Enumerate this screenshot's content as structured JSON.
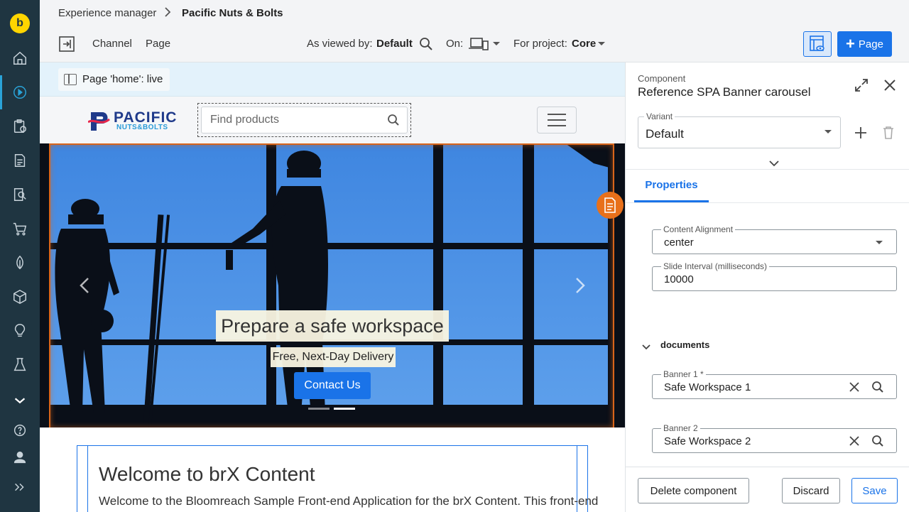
{
  "colors": {
    "nav_bg": "#1f3541",
    "accent": "#1a73e8",
    "brand_yellow": "#ffd500",
    "highlight_orange": "#e8701a"
  },
  "topbar": {
    "breadcrumb_app": "Experience manager",
    "breadcrumb_channel": "Pacific Nuts & Bolts",
    "channel_label": "Channel",
    "page_label": "Page",
    "viewed_by_label": "As viewed by:",
    "viewed_by_value": "Default",
    "on_label": "On:",
    "project_label": "For project:",
    "project_value": "Core",
    "page_button_label": "Page"
  },
  "page_status": {
    "label": "Page 'home': live"
  },
  "site": {
    "logo_line1": "PACIFIC",
    "logo_line2": "NUTS&BOLTS",
    "search_placeholder": "Find products",
    "banner": {
      "title": "Prepare a safe workspace",
      "subtitle": "Free, Next-Day Delivery",
      "button_label": "Contact Us"
    },
    "welcome_title": "Welcome to brX Content",
    "welcome_text": "Welcome to the Bloomreach Sample Front-end Application for the brX Content. This front-end"
  },
  "panel": {
    "kicker": "Component",
    "title": "Reference SPA Banner carousel",
    "variant_label": "Variant",
    "variant_value": "Default",
    "tab_properties": "Properties",
    "content_alignment_label": "Content Alignment",
    "content_alignment_value": "center",
    "slide_interval_label": "Slide Interval (milliseconds)",
    "slide_interval_value": "10000",
    "documents_label": "documents",
    "banner1_label": "Banner 1 *",
    "banner1_value": "Safe Workspace 1",
    "banner2_label": "Banner 2",
    "banner2_value": "Safe Workspace 2",
    "delete_label": "Delete component",
    "discard_label": "Discard",
    "save_label": "Save"
  },
  "nav_icons": [
    "home-icon",
    "experience-manager-icon",
    "projects-icon",
    "content-icon",
    "site-search-icon",
    "commerce-icon",
    "seo-icon",
    "catalog-icon",
    "insights-icon",
    "experiments-icon",
    "more-icon",
    "help-icon",
    "user-icon",
    "expand-nav-icon"
  ]
}
